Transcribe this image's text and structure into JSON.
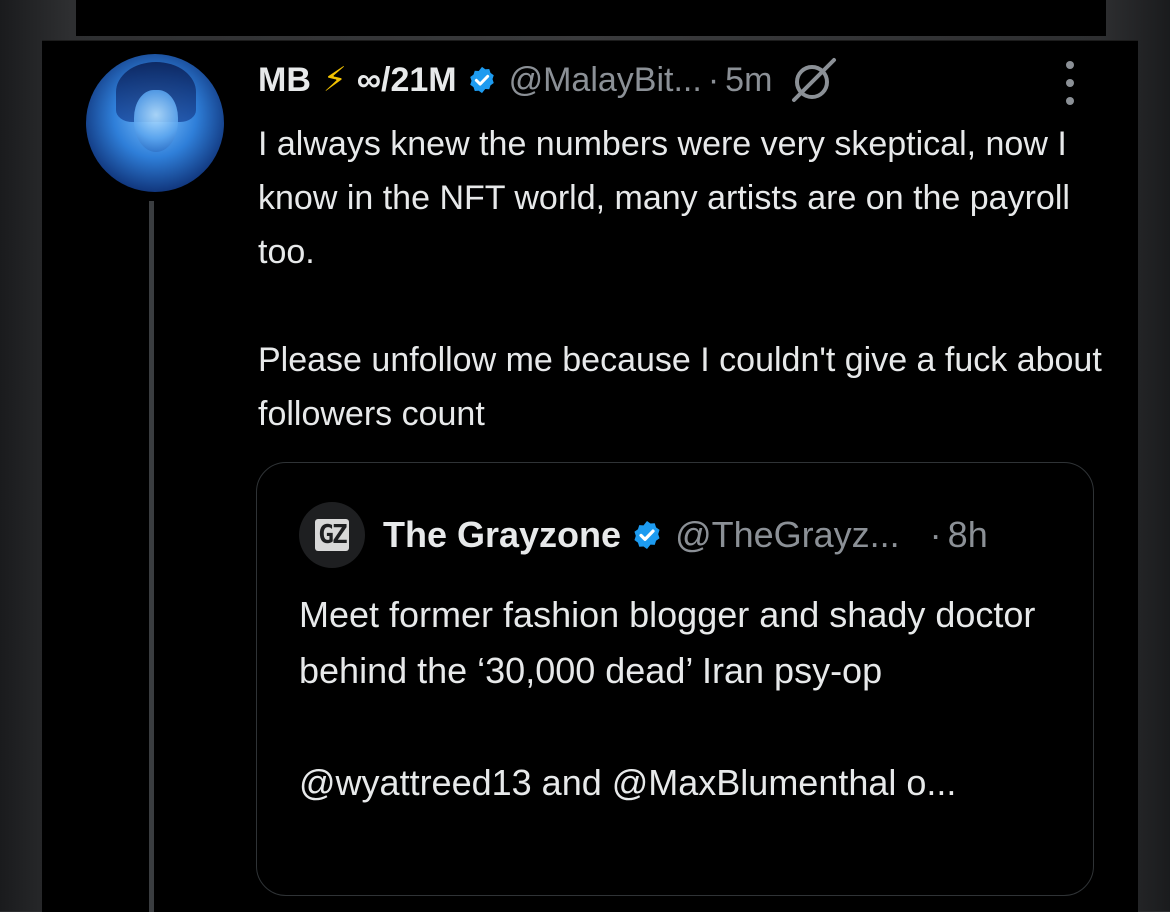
{
  "post": {
    "display_name": "MB",
    "name_suffix": "∞/21M",
    "handle": "@MalayBit...",
    "separator": "·",
    "time": "5m",
    "paragraphs": [
      "I always knew the numbers were very skeptical, now I know in the NFT world, many artists are on the payroll too.",
      "Please unfollow me because I couldn't give a fuck about followers count"
    ]
  },
  "quote": {
    "avatar_text": "GZ",
    "display_name": "The Grayzone",
    "handle": "@TheGrayz...",
    "separator": "·",
    "time": "8h",
    "paragraphs": [
      "Meet former fashion blogger and shady doctor behind the ‘30,000 dead’ Iran psy-op",
      "@wyattreed13 and @MaxBlumenthal o..."
    ]
  },
  "icons": {
    "verified": "verified-badge-icon",
    "grok": "grok-icon",
    "more": "more-options-icon",
    "bolt": "lightning-icon"
  },
  "colors": {
    "background": "#000000",
    "text": "#e7e9ea",
    "secondary_text": "#8b9096",
    "verified": "#1d9bf0",
    "bolt": "#f2c200"
  }
}
